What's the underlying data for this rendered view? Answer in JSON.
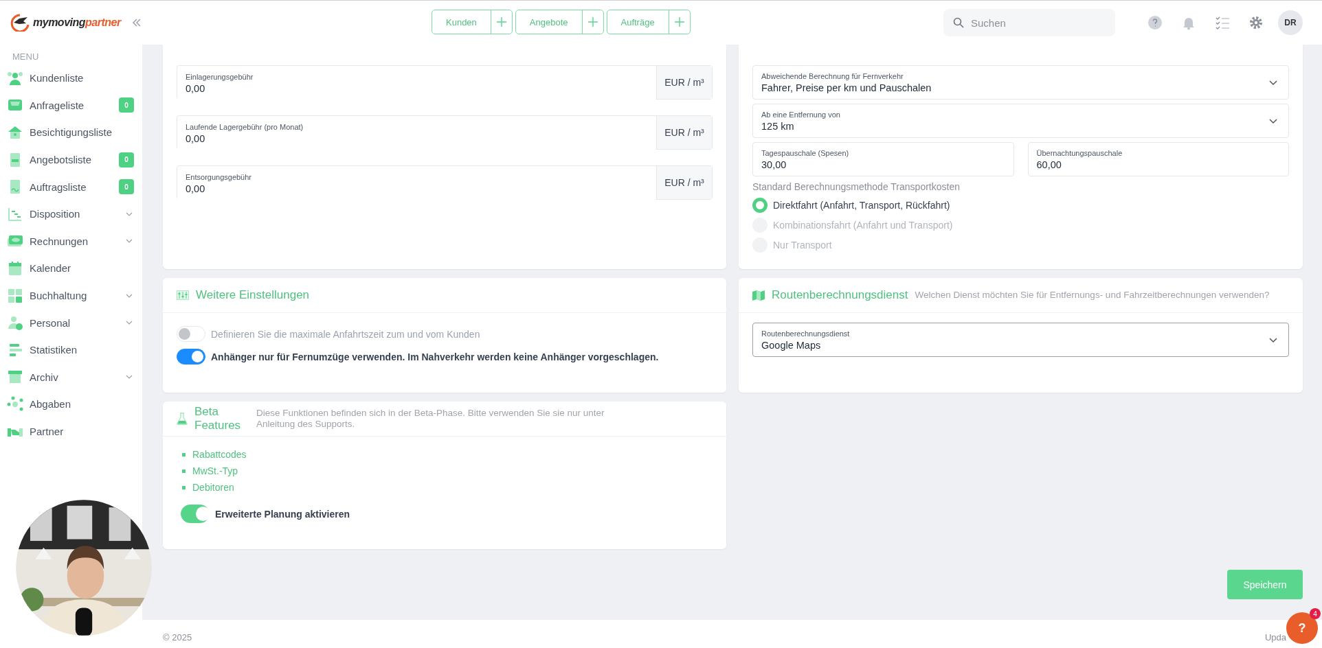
{
  "header": {
    "logo": {
      "dark": "mymoving",
      "accent": "partner"
    },
    "quick_actions": [
      {
        "label": "Kunden"
      },
      {
        "label": "Angebote"
      },
      {
        "label": "Aufträge"
      }
    ],
    "search": {
      "placeholder": "Suchen"
    },
    "avatar": "DR"
  },
  "sidebar": {
    "heading": "MENU",
    "items": [
      {
        "label": "Kundenliste",
        "expandable": false
      },
      {
        "label": "Anfrageliste",
        "badge": "0",
        "expandable": false
      },
      {
        "label": "Besichtigungsliste",
        "expandable": false
      },
      {
        "label": "Angebotsliste",
        "badge": "0",
        "expandable": false
      },
      {
        "label": "Auftragsliste",
        "badge": "0",
        "expandable": false
      },
      {
        "label": "Disposition",
        "expandable": true
      },
      {
        "label": "Rechnungen",
        "expandable": true
      },
      {
        "label": "Kalender",
        "expandable": false
      },
      {
        "label": "Buchhaltung",
        "expandable": true
      },
      {
        "label": "Personal",
        "expandable": true
      },
      {
        "label": "Statistiken",
        "expandable": false
      },
      {
        "label": "Archiv",
        "expandable": true
      },
      {
        "label": "Abgaben",
        "expandable": false
      },
      {
        "label": "Partner",
        "expandable": false
      }
    ]
  },
  "storage_card": {
    "fields": [
      {
        "label": "Einlagerungsgebühr",
        "value": "0,00",
        "unit": "EUR / m³"
      },
      {
        "label": "Laufende Lagergebühr (pro Monat)",
        "value": "0,00",
        "unit": "EUR / m³"
      },
      {
        "label": "Entsorgungsgebühr",
        "value": "0,00",
        "unit": "EUR / m³"
      }
    ]
  },
  "long_distance_card": {
    "selects": [
      {
        "label": "Abweichende Berechnung für Fernverkehr",
        "value": "Fahrer, Preise per km und Pauschalen"
      },
      {
        "label": "Ab eine Entfernung von",
        "value": "125 km"
      }
    ],
    "inputs": [
      {
        "label": "Tagespauschale (Spesen)",
        "value": "30,00"
      },
      {
        "label": "Übernachtungspauschale",
        "value": "60,00"
      }
    ],
    "method_heading": "Standard Berechnungsmethode Transportkosten",
    "methods": [
      {
        "label": "Direktfahrt (Anfahrt, Transport, Rückfahrt)",
        "selected": true
      },
      {
        "label": "Kombinationsfahrt (Anfahrt und Transport)",
        "selected": false
      },
      {
        "label": "Nur Transport",
        "selected": false
      }
    ]
  },
  "more_settings": {
    "title": "Weitere Einstellungen",
    "toggles": [
      {
        "label": "Definieren Sie die maximale Anfahrtszeit zum und vom Kunden",
        "on": false
      },
      {
        "label": "Anhänger nur für Fernumzüge verwenden. Im Nahverkehr werden keine Anhänger vorgeschlagen.",
        "on": true
      }
    ]
  },
  "routing": {
    "title": "Routenberechnungsdienst",
    "description": "Welchen Dienst möchten Sie für Entfernungs- und Fahrzeitberechnungen verwenden?",
    "select": {
      "label": "Routenberechnungsdienst",
      "value": "Google Maps"
    }
  },
  "beta": {
    "title": "Beta Features",
    "description": "Diese Funktionen befinden sich in der Beta-Phase. Bitte verwenden Sie sie nur unter Anleitung des Supports.",
    "features": [
      "Rabattcodes",
      "MwSt.-Typ",
      "Debitoren"
    ],
    "toggle": {
      "label": "Erweiterte Planung aktivieren",
      "on": true
    }
  },
  "save_button": "Speichern",
  "footer": {
    "copyright": "© 2025",
    "right": "Upda"
  },
  "help": {
    "label": "?",
    "badge": "4"
  }
}
